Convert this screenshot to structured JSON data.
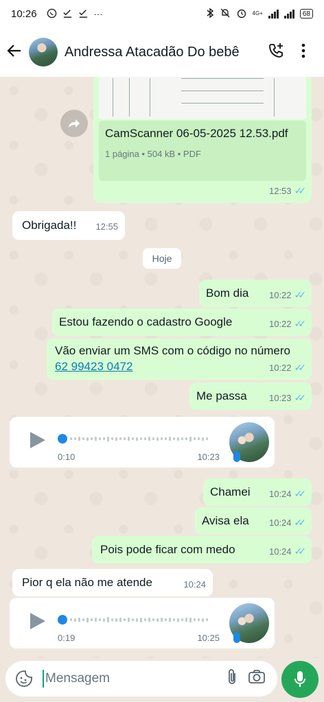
{
  "status_bar": {
    "time": "10:26",
    "network_label": "4G+",
    "battery": "68"
  },
  "header": {
    "contact_name": "Andressa Atacadão Do bebê"
  },
  "document_message": {
    "file_name": "CamScanner 06-05-2025 12.53.pdf",
    "file_details": "1 página • 504 kB • PDF",
    "time": "12:53"
  },
  "date_separator": "Hoje",
  "messages": [
    {
      "direction": "in",
      "text": "Obrigada!!",
      "time": "12:55"
    },
    {
      "direction": "out",
      "text": "Bom dia",
      "time": "10:22"
    },
    {
      "direction": "out",
      "text": "Estou fazendo o cadastro Google",
      "time": "10:22"
    },
    {
      "direction": "out",
      "text_prefix": "Vão enviar um SMS com o código no número ",
      "link": "62 99423 0472",
      "time": "10:22"
    },
    {
      "direction": "out",
      "text": "Me passa",
      "time": "10:23"
    },
    {
      "direction": "in",
      "type": "voice",
      "duration": "0:10",
      "time": "10:23"
    },
    {
      "direction": "out",
      "text": "Chamei",
      "time": "10:24"
    },
    {
      "direction": "out",
      "text": "Avisa ela",
      "time": "10:24"
    },
    {
      "direction": "out",
      "text": "Pois pode ficar com medo",
      "time": "10:24"
    },
    {
      "direction": "in",
      "text": "Pior q ela não me atende",
      "time": "10:24"
    },
    {
      "direction": "in",
      "type": "voice",
      "duration": "0:19",
      "time": "10:25"
    }
  ],
  "input": {
    "placeholder": "Mensagem"
  },
  "icons": {
    "back": "arrow-left-icon",
    "call": "add-call-icon",
    "menu": "more-vert-icon",
    "forward": "forward-icon",
    "emoji": "sticker-icon",
    "attach": "paperclip-icon",
    "camera": "camera-icon",
    "mic": "mic-icon"
  },
  "colors": {
    "outgoing_bubble": "#d9fdd3",
    "incoming_bubble": "#ffffff",
    "read_ticks": "#53bdeb",
    "mic_button": "#25a75a"
  }
}
